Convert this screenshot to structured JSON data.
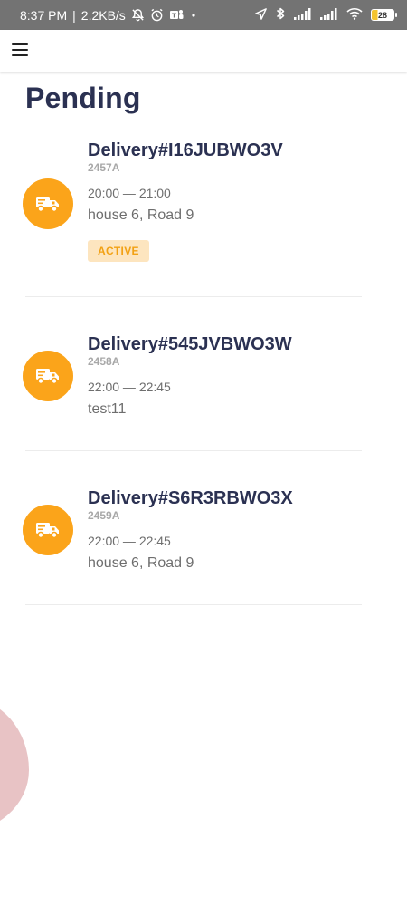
{
  "status_bar": {
    "time": "8:37 PM",
    "separator": "|",
    "speed": "2.2KB/s",
    "battery": "28",
    "icons": [
      "muted-bell-icon",
      "alarm-icon",
      "teams-icon",
      "dot-icon",
      "location-arrow-icon",
      "bluetooth-icon",
      "signal-icon",
      "signal-icon",
      "wifi-icon",
      "battery-icon"
    ]
  },
  "app_bar": {
    "menu_icon": "hamburger-menu-icon"
  },
  "page": {
    "title": "Pending"
  },
  "deliveries": [
    {
      "title": "Delivery#I16JUBWO3V",
      "code": "2457A",
      "time": "20:00 — 21:00",
      "address": "house 6, Road 9",
      "status": "ACTIVE",
      "icon": "truck-icon"
    },
    {
      "title": "Delivery#545JVBWO3W",
      "code": "2458A",
      "time": "22:00 — 22:45",
      "address": "test11",
      "icon": "truck-icon"
    },
    {
      "title": "Delivery#S6R3RBWO3X",
      "code": "2459A",
      "time": "22:00 — 22:45",
      "address": "house 6, Road 9",
      "icon": "truck-icon"
    }
  ],
  "colors": {
    "accent": "#fba41a",
    "title": "#2b3152",
    "badge_bg": "#fde5bf",
    "badge_text": "#f2a114",
    "status_bar": "#737373",
    "decor": "#e8c3c5"
  }
}
